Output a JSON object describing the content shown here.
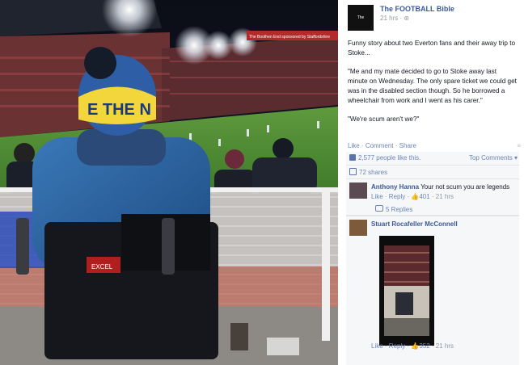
{
  "post": {
    "page_name": "The FOOTBALL Bible",
    "logo_text": "The FOOTBALL Bible",
    "time": "21 hrs",
    "paragraphs": [
      "Funny story about two Everton fans and their away trip to Stoke...",
      "\"Me and my mate decided to go to Stoke away last minute on Wednesday. The only spare ticket we could get was in the disabled section though. So he borrowed a wheelchair from work and I went as his carer.\"",
      "\"We're scum aren't we?\""
    ],
    "actions": {
      "like": "Like",
      "comment": "Comment",
      "share": "Share",
      "separator": "·"
    }
  },
  "photo": {
    "hat_text": "E THE N",
    "wheelchair_badge": "EXCEL",
    "stand_banner": "The Boothen End sponsored by Staffordshire"
  },
  "ufi": {
    "likes": "2,577 people like this.",
    "top_comments": "Top Comments ▾",
    "shares": "72 shares",
    "comments": [
      {
        "author": "Anthony Hanna",
        "text": "Your not scum you are legends",
        "like": "Like",
        "reply": "Reply",
        "likes": "401",
        "time": "21 hrs",
        "replies": "5 Replies"
      },
      {
        "author": "Stuart Rocafeller McConnell",
        "like": "Like",
        "reply": "Reply",
        "likes": "352",
        "time": "21 hrs"
      }
    ]
  },
  "colors": {
    "link": "#3b5998",
    "text": "#141823",
    "meta": "#9197a3",
    "ufi_bg": "#f6f7f9"
  }
}
